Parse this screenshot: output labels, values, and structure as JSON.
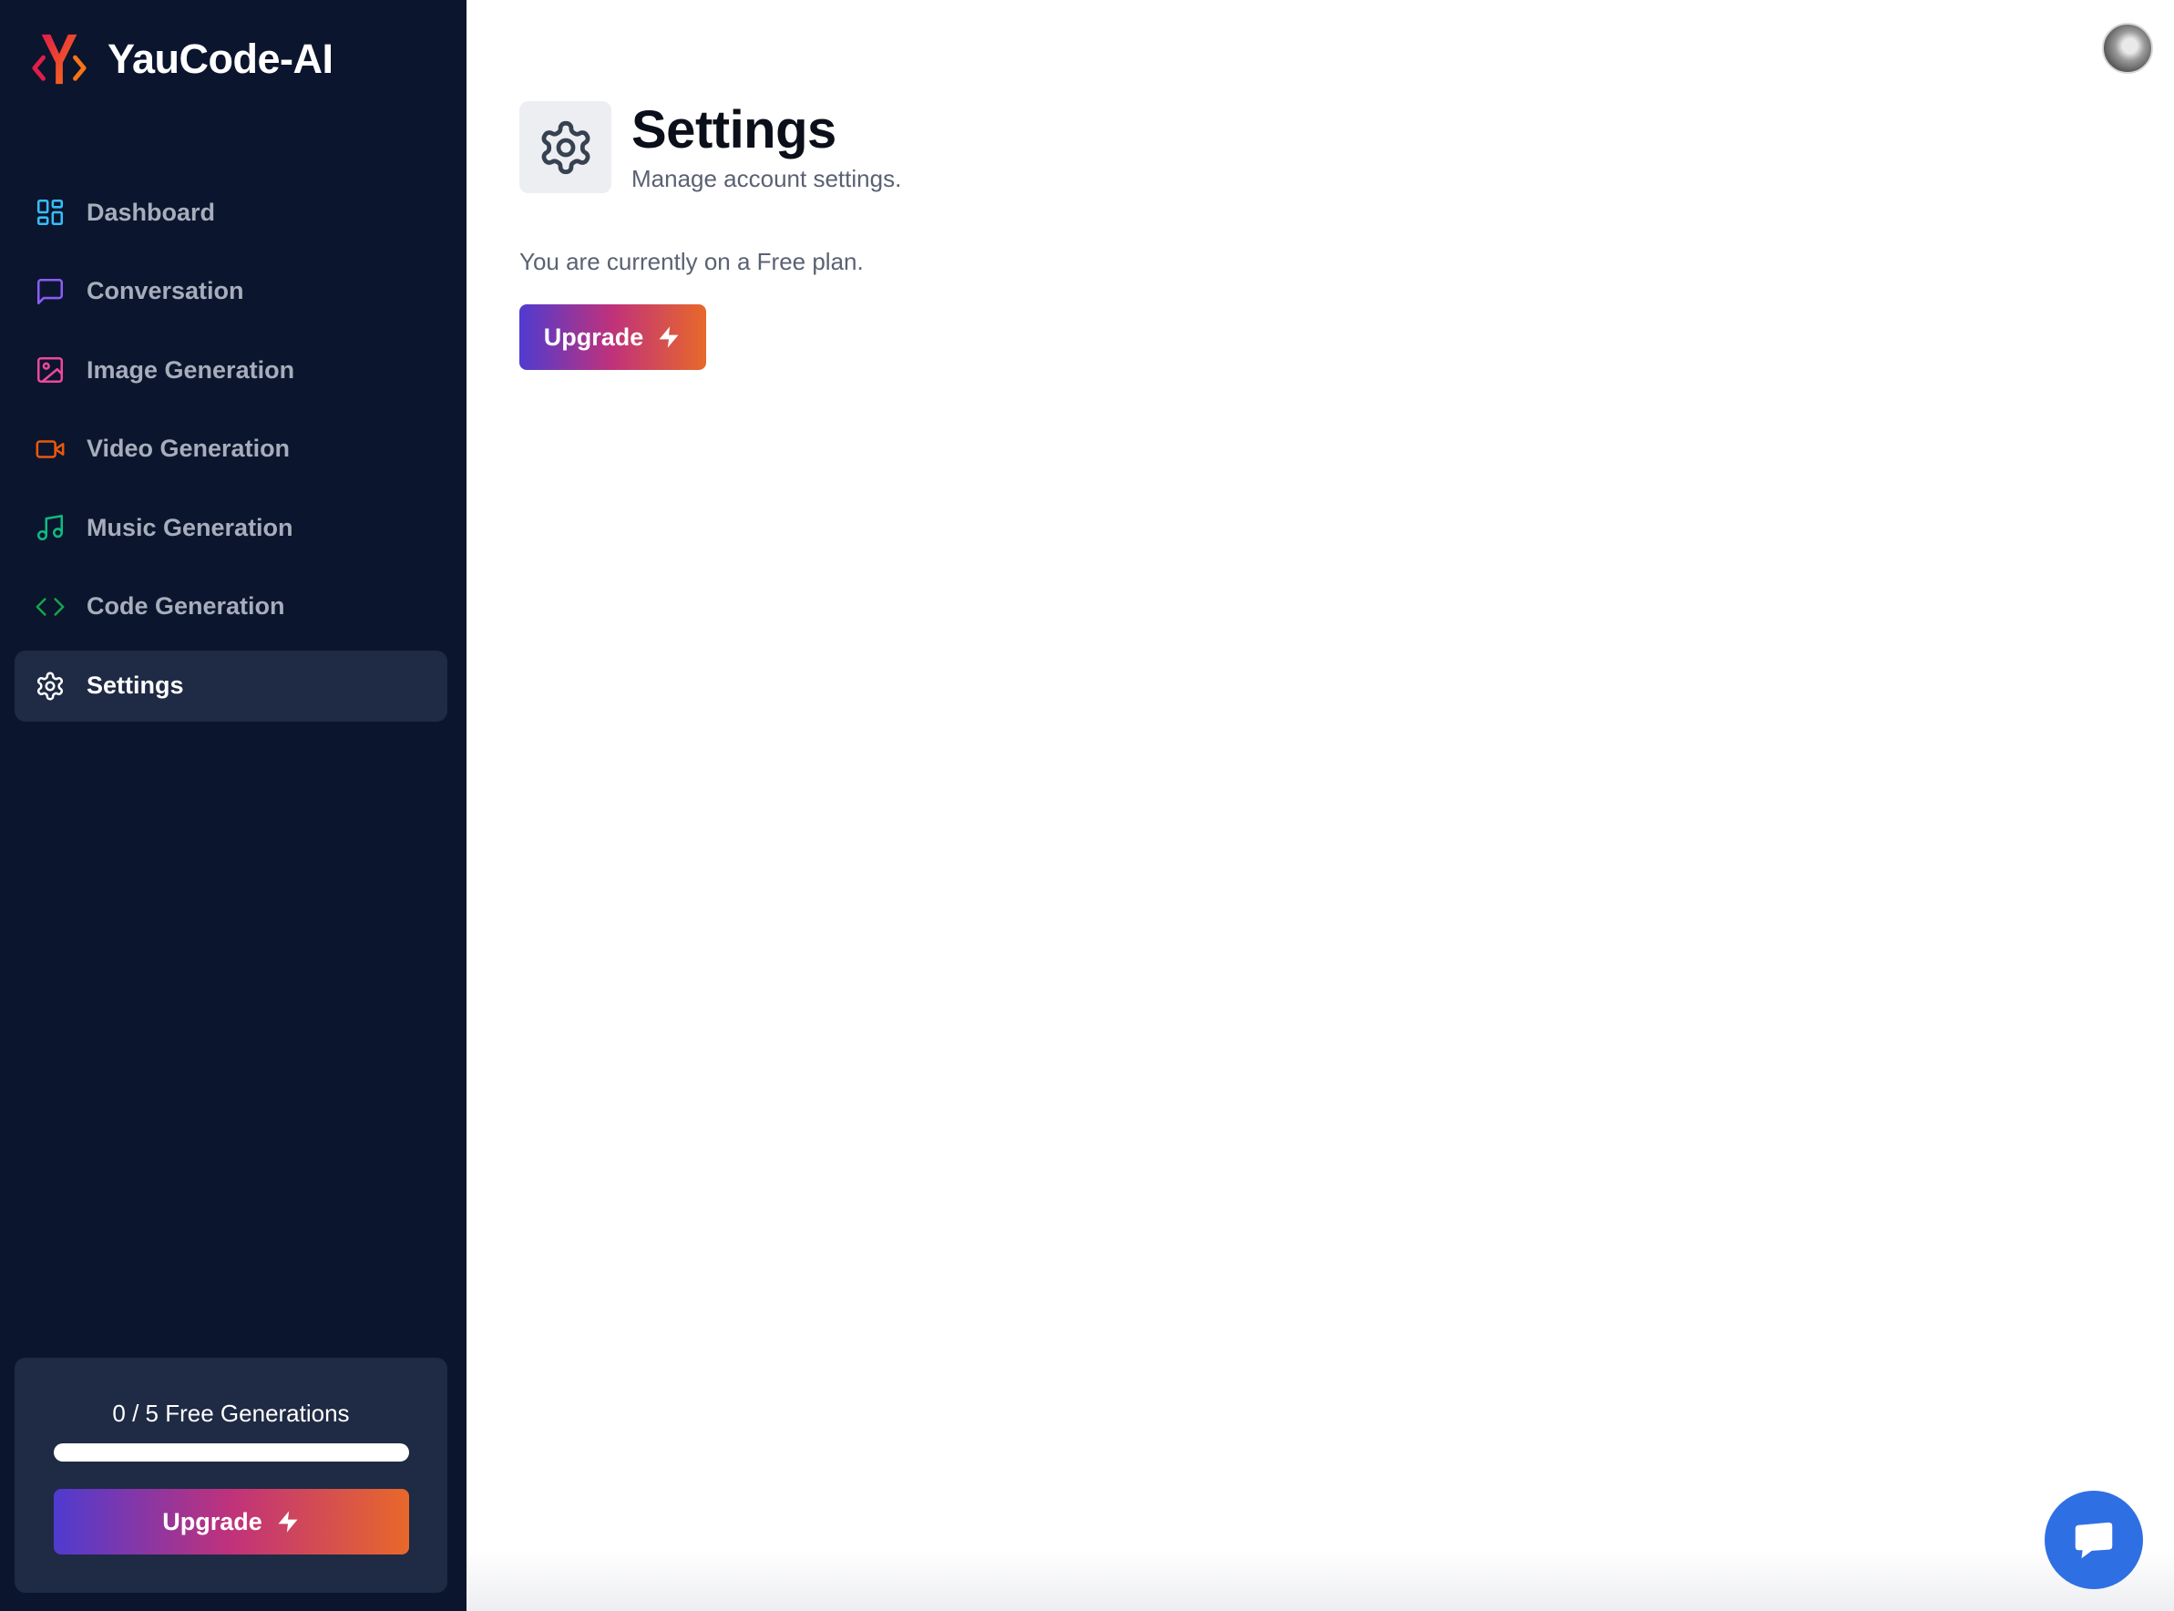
{
  "brand": {
    "name": "YauCode-AI",
    "logo_icon": "yaucode-logo-icon"
  },
  "sidebar": {
    "items": [
      {
        "label": "Dashboard",
        "icon": "dashboard-icon",
        "color": "#38bdf8",
        "active": false
      },
      {
        "label": "Conversation",
        "icon": "message-square-icon",
        "color": "#8b5cf6",
        "active": false
      },
      {
        "label": "Image Generation",
        "icon": "image-icon",
        "color": "#ec4899",
        "active": false
      },
      {
        "label": "Video Generation",
        "icon": "video-icon",
        "color": "#ea580c",
        "active": false
      },
      {
        "label": "Music Generation",
        "icon": "music-icon",
        "color": "#10b981",
        "active": false
      },
      {
        "label": "Code Generation",
        "icon": "code-icon",
        "color": "#16a34a",
        "active": false
      },
      {
        "label": "Settings",
        "icon": "settings-icon",
        "color": "#ffffff",
        "active": true
      }
    ]
  },
  "usage": {
    "text": "0 / 5 Free Generations",
    "used": 0,
    "limit": 5,
    "upgrade_label": "Upgrade"
  },
  "header": {
    "title": "Settings",
    "subtitle": "Manage account settings.",
    "icon": "settings-icon"
  },
  "plan": {
    "text": "You are currently on a Free plan.",
    "upgrade_label": "Upgrade"
  },
  "colors": {
    "sidebar_bg": "#0b152e",
    "active_item_bg": "#1f2a44",
    "gradient_start": "#4f3bd0",
    "gradient_mid": "#c0327a",
    "gradient_end": "#e8682a",
    "chat_button": "#2f6fe4"
  }
}
